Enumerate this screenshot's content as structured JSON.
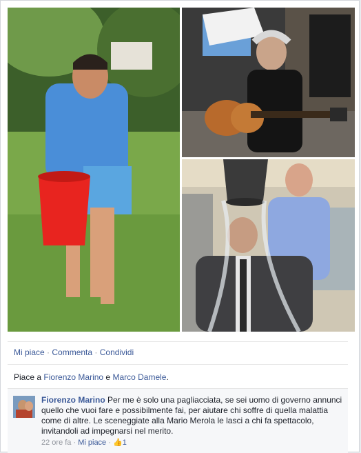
{
  "photos": [
    {
      "name": "photo-man-red-bucket",
      "description_icon": "photo-icon"
    },
    {
      "name": "photo-man-guitar"
    },
    {
      "name": "photo-man-bucket-dumped"
    }
  ],
  "actions": {
    "like": "Mi piace",
    "comment": "Commenta",
    "share": "Condividi",
    "separator": "·"
  },
  "likes": {
    "prefix": "Piace a",
    "user1": "Fiorenzo Marino",
    "conj": "e",
    "user2": "Marco Damele",
    "suffix": "."
  },
  "comment": {
    "author": "Fiorenzo Marino",
    "text": "Per me è solo una pagliacciata, se sei uomo di governo annunci quello che vuoi fare e possibilmente fai, per aiutare chi soffre di quella malattia come di altre. Le sceneggiate alla Mario Merola le lasci a chi fa spettacolo, invitandoli ad impegnarsi nel merito.",
    "time": "22 ore fa",
    "like_label": "Mi piace",
    "like_count": "1",
    "separator": "·"
  },
  "colors": {
    "link": "#3b5998",
    "meta": "#90949c",
    "bucket_red": "#e8241f"
  }
}
